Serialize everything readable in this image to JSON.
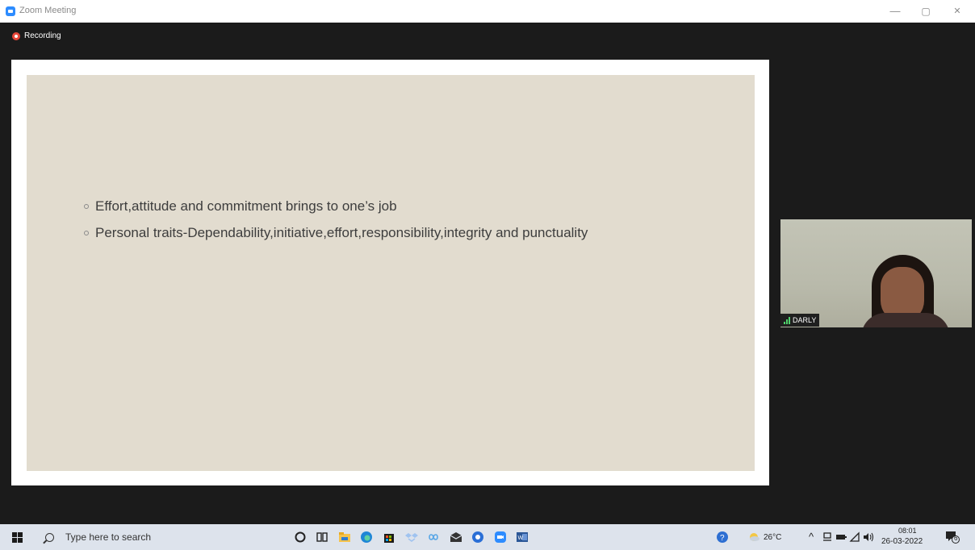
{
  "window": {
    "title": "Zoom Meeting",
    "minimize": "—",
    "restore": "▢",
    "close": "✕"
  },
  "recording": {
    "label": "Recording"
  },
  "slide": {
    "bullets": [
      "Effort,attitude and commitment brings to one’s job",
      "Personal traits-Dependability,initiative,effort,responsibility,integrity and punctuality"
    ]
  },
  "participant": {
    "name": "DARLY"
  },
  "taskbar": {
    "search_placeholder": "Type here to search",
    "weather": "26°C",
    "time": "08:01",
    "date": "26-03-2022",
    "notifications": "6"
  },
  "colors": {
    "zoom_blue": "#2d8cff",
    "record_red": "#e8473a",
    "slide_bg": "#e2dccf"
  }
}
